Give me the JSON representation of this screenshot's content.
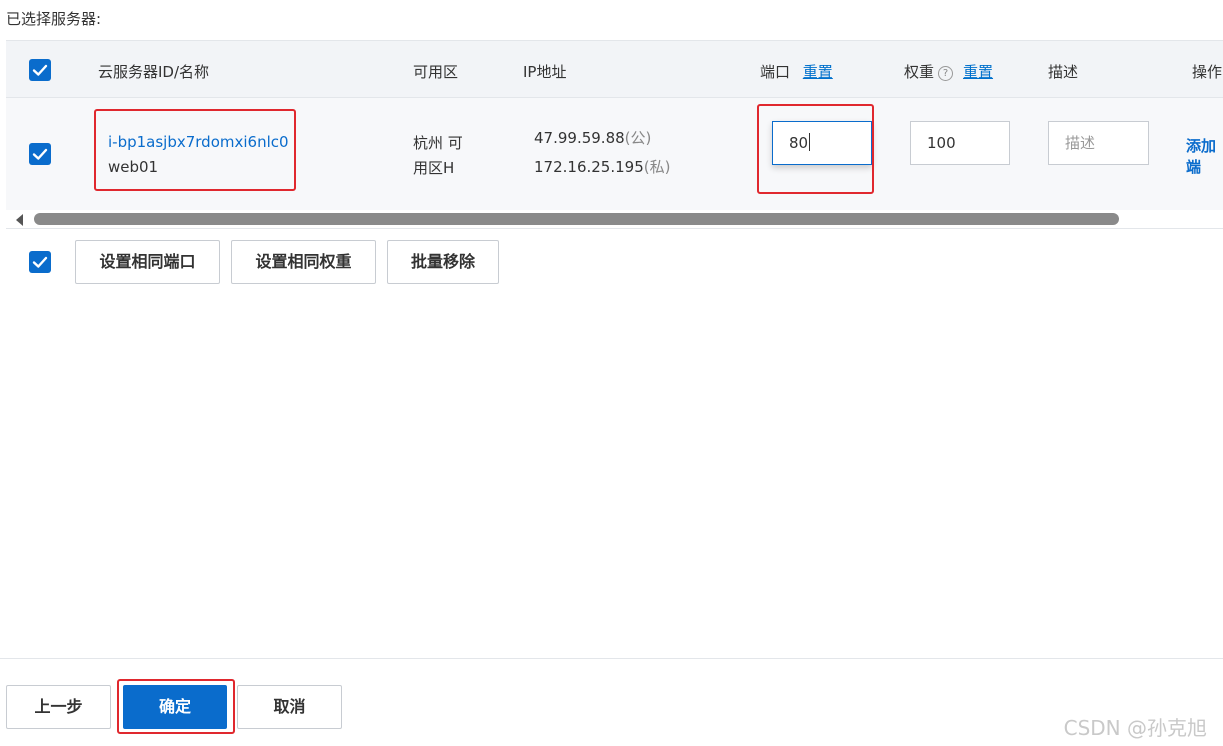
{
  "section_title": "已选择服务器:",
  "columns": {
    "instance": "云服务器ID/名称",
    "zone": "可用区",
    "ip": "IP地址",
    "port": "端口",
    "port_reset": "重置",
    "weight": "权重",
    "weight_help": "?",
    "weight_reset": "重置",
    "description": "描述",
    "actions": "操作"
  },
  "row": {
    "instance_id": "i-bp1asjbx7rdomxi6nlc0",
    "instance_name": "web01",
    "zone_line1": "杭州 可",
    "zone_line2": "用区H",
    "public_ip": "47.99.59.88",
    "public_tag": "(公)",
    "private_ip": "172.16.25.195",
    "private_tag": "(私)",
    "port_value": "80",
    "weight_value": "100",
    "description_placeholder": "描述",
    "action_label": "添加端"
  },
  "batch_actions": {
    "same_port": "设置相同端口",
    "same_weight": "设置相同权重",
    "batch_remove": "批量移除"
  },
  "footer": {
    "prev": "上一步",
    "confirm": "确定",
    "cancel": "取消"
  },
  "watermark": "CSDN @孙克旭",
  "colors": {
    "accent": "#0a6ccc",
    "highlight": "#e0282e"
  }
}
